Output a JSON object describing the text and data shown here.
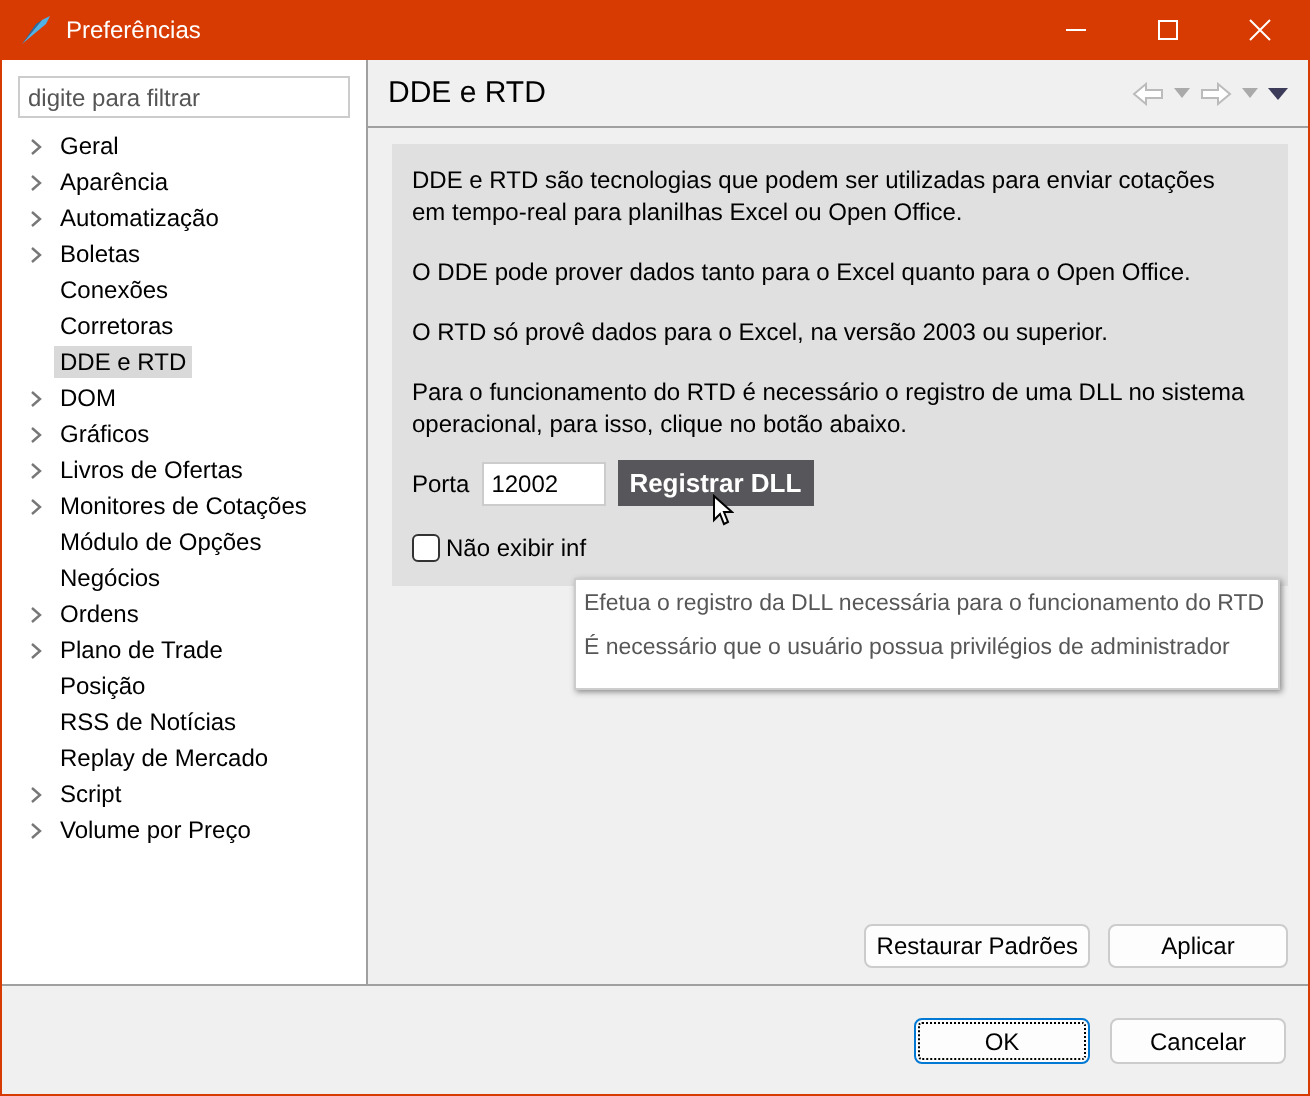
{
  "window": {
    "title": "Preferências"
  },
  "filter": {
    "placeholder": "digite para filtrar"
  },
  "tree": [
    {
      "label": "Geral",
      "expandable": true,
      "selected": false
    },
    {
      "label": "Aparência",
      "expandable": true,
      "selected": false
    },
    {
      "label": "Automatização",
      "expandable": true,
      "selected": false
    },
    {
      "label": "Boletas",
      "expandable": true,
      "selected": false
    },
    {
      "label": "Conexões",
      "expandable": false,
      "selected": false
    },
    {
      "label": "Corretoras",
      "expandable": false,
      "selected": false
    },
    {
      "label": "DDE e RTD",
      "expandable": false,
      "selected": true
    },
    {
      "label": "DOM",
      "expandable": true,
      "selected": false
    },
    {
      "label": "Gráficos",
      "expandable": true,
      "selected": false
    },
    {
      "label": "Livros de Ofertas",
      "expandable": true,
      "selected": false
    },
    {
      "label": "Monitores de Cotações",
      "expandable": true,
      "selected": false
    },
    {
      "label": "Módulo de Opções",
      "expandable": false,
      "selected": false
    },
    {
      "label": "Negócios",
      "expandable": false,
      "selected": false
    },
    {
      "label": "Ordens",
      "expandable": true,
      "selected": false
    },
    {
      "label": "Plano de Trade",
      "expandable": true,
      "selected": false
    },
    {
      "label": "Posição",
      "expandable": false,
      "selected": false
    },
    {
      "label": "RSS de Notícias",
      "expandable": false,
      "selected": false
    },
    {
      "label": "Replay de Mercado",
      "expandable": false,
      "selected": false
    },
    {
      "label": "Script",
      "expandable": true,
      "selected": false
    },
    {
      "label": "Volume por Preço",
      "expandable": true,
      "selected": false
    }
  ],
  "page": {
    "title": "DDE e RTD",
    "paragraphs": [
      "DDE e RTD são tecnologias que podem ser utilizadas para enviar cotações\nem tempo-real para planilhas Excel ou Open Office.",
      "O DDE pode prover dados tanto para o Excel quanto para o Open Office.",
      "O RTD só provê dados para o Excel, na versão 2003 ou superior.",
      "Para o funcionamento do RTD é necessário o registro de uma DLL no sistema\noperacional, para isso, clique no botão abaixo."
    ],
    "port_label": "Porta",
    "port_value": "12002",
    "register_button": "Registrar DLL",
    "checkbox": {
      "label": "Não exibir inf",
      "checked": false
    },
    "tooltip": [
      "Efetua o registro da DLL necessária para o funcionamento do RTD",
      "É necessário que o usuário possua privilégios de administrador"
    ],
    "buttons": [
      "Restaurar Padrões",
      "Aplicar"
    ]
  },
  "dialog_buttons": [
    {
      "label": "OK",
      "focused": true
    },
    {
      "label": "Cancelar",
      "focused": false
    }
  ]
}
